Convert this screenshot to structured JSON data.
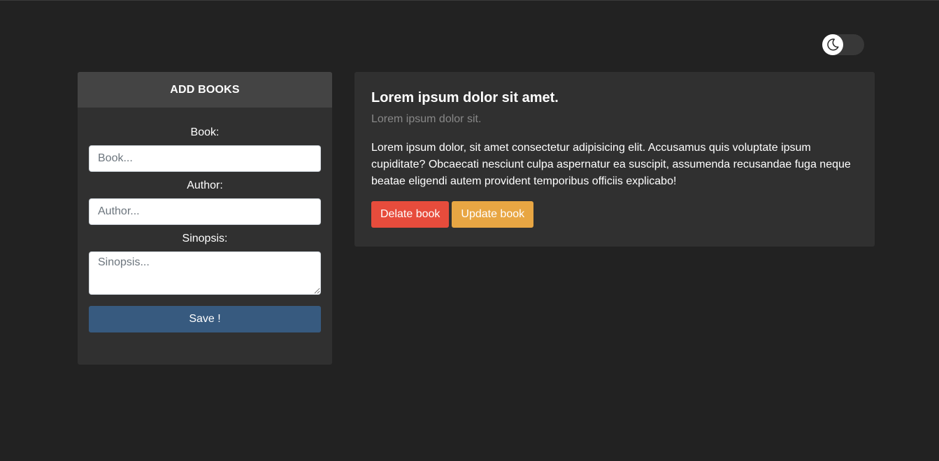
{
  "theme_toggle": {
    "icon": "moon-icon",
    "state": "dark"
  },
  "add_books": {
    "header": "ADD BOOKS",
    "book_label": "Book:",
    "book_placeholder": "Book...",
    "book_value": "",
    "author_label": "Author:",
    "author_placeholder": "Author...",
    "author_value": "",
    "sinopsis_label": "Sinopsis:",
    "sinopsis_placeholder": "Sinopsis...",
    "sinopsis_value": "",
    "save_label": "Save !"
  },
  "book_card": {
    "title": "Lorem ipsum dolor sit amet.",
    "author": "Lorem ipsum dolor sit.",
    "sinopsis": "Lorem ipsum dolor, sit amet consectetur adipisicing elit. Accusamus quis voluptate ipsum cupiditate? Obcaecati nesciunt culpa aspernatur ea suscipit, assumenda recusandae fuga neque beatae eligendi autem provident temporibus officiis explicabo!",
    "delete_label": "Delate book",
    "update_label": "Update book"
  },
  "colors": {
    "background": "#222222",
    "panel": "#303030",
    "panel_header": "#444444",
    "save_button": "#375a7f",
    "delete_button": "#e74c3c",
    "update_button": "#e8a643"
  }
}
